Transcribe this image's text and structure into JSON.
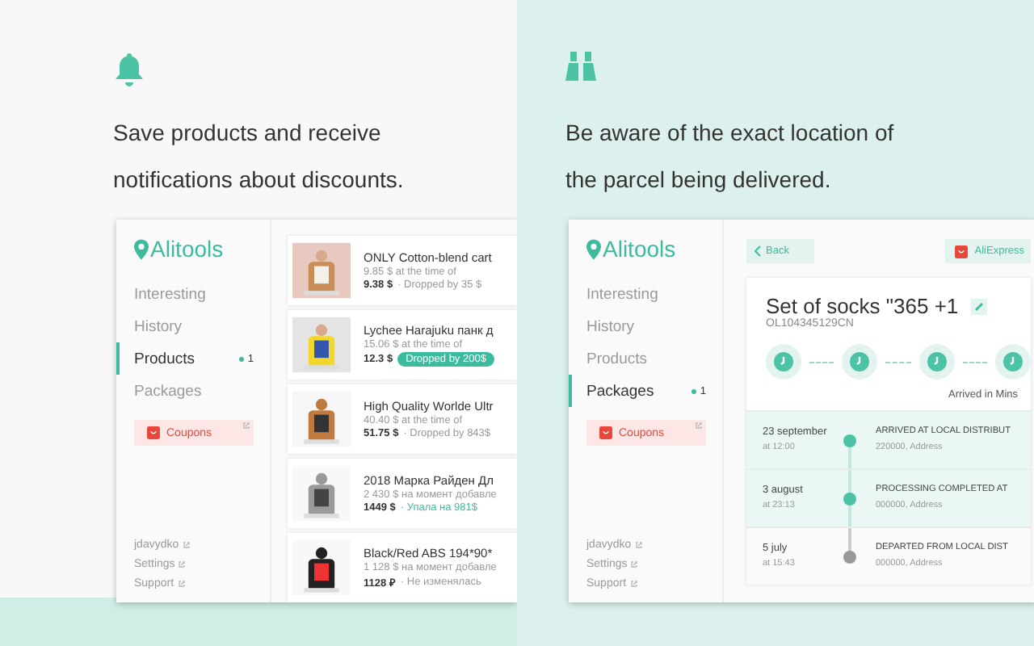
{
  "panels": [
    {
      "kind": "products",
      "caption": "Save products and receive notifications about discounts.",
      "app": {
        "logo": "Alitools",
        "nav": [
          {
            "label": "Interesting",
            "selected": false
          },
          {
            "label": "History",
            "selected": false
          },
          {
            "label": "Products",
            "selected": true,
            "badge": "1"
          },
          {
            "label": "Packages",
            "selected": false
          }
        ],
        "coupons": "Coupons",
        "links": [
          "jdavydko",
          "Settings",
          "Support"
        ]
      },
      "products": [
        {
          "title": "ONLY Cotton-blend cart",
          "was": "9.85 $ at the time of",
          "price": "9.38 $",
          "note": "· Dropped by 35 $",
          "kind": "muted"
        },
        {
          "title": "Lychee Harajuku панк д",
          "was": "15.06 $ at the time of",
          "price": "12.3 $",
          "note": "Dropped by 200$",
          "kind": "pill"
        },
        {
          "title": "High Quality Worlde Ultr",
          "was": "40.40 $ at the time of",
          "price": "51.75 $",
          "note": "· Dropped by 843$",
          "kind": "muted"
        },
        {
          "title": "2018 Марка Райден Дл",
          "was": "2 430 $ на момент добавле",
          "price": "1449 $",
          "note": "· Упала на 981$",
          "kind": "accent"
        },
        {
          "title": "Black/Red ABS 194*90*",
          "was": "1 128 $ на момент добавле",
          "price": "1128 ₽",
          "note": "· Не изменялась",
          "kind": "muted"
        }
      ]
    },
    {
      "kind": "tracking",
      "caption": "Be aware of the exact location of the parcel being delivered.",
      "app": {
        "logo": "Alitools",
        "nav": [
          {
            "label": "Interesting",
            "selected": false
          },
          {
            "label": "History",
            "selected": false
          },
          {
            "label": "Products",
            "selected": false
          },
          {
            "label": "Packages",
            "selected": true,
            "badge": "1"
          }
        ],
        "coupons": "Coupons",
        "links": [
          "jdavydko",
          "Settings",
          "Support"
        ]
      },
      "back": "Back",
      "store": "AliExpress",
      "title": "Set of socks \"365 +1",
      "tracking_number": "OL104345129CN",
      "step_label": "Arrived in Mins",
      "events": [
        {
          "date": "23 september",
          "time": "at 12:00",
          "status": "ARRIVED AT LOCAL DISTRIBUT",
          "address": "220000, Address",
          "done": true
        },
        {
          "date": "3 august",
          "time": "at 23:13",
          "status": "PROCESSING COMPLETED AT",
          "address": "000000, Address",
          "done": true
        },
        {
          "date": "5 july",
          "time": "at 15:43",
          "status": "DEPARTED FROM LOCAL DIST",
          "address": "000000, Address",
          "done": false
        }
      ]
    }
  ]
}
